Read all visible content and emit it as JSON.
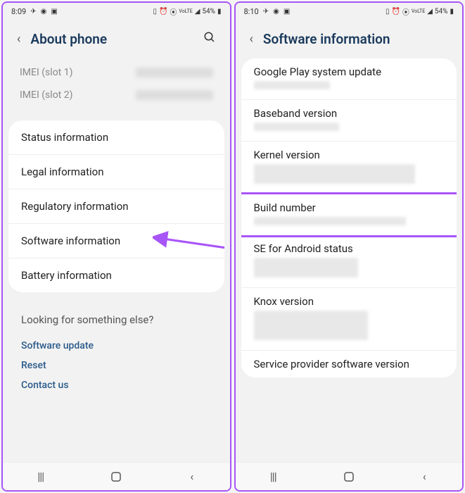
{
  "left_phone": {
    "status": {
      "time": "8:09",
      "battery": "54%"
    },
    "header": {
      "title": "About phone"
    },
    "imei": [
      {
        "label": "IMEI (slot 1)"
      },
      {
        "label": "IMEI (slot 2)"
      }
    ],
    "info_items": [
      "Status information",
      "Legal information",
      "Regulatory information",
      "Software information",
      "Battery information"
    ],
    "looking": {
      "title": "Looking for something else?",
      "links": [
        "Software update",
        "Reset",
        "Contact us"
      ]
    }
  },
  "right_phone": {
    "status": {
      "time": "8:10",
      "battery": "54%"
    },
    "header": {
      "title": "Software information"
    },
    "items": [
      {
        "title": "Google Play system update",
        "blur": "short"
      },
      {
        "title": "Baseband version",
        "blur": "short"
      },
      {
        "title": "Kernel version",
        "blur": "tall"
      },
      {
        "title": "Build number",
        "blur": "short",
        "highlight": true
      },
      {
        "title": "SE for Android status",
        "blur": "tall"
      },
      {
        "title": "Knox version",
        "blur": "xtall"
      },
      {
        "title": "Service provider software version",
        "blur": "none"
      }
    ]
  }
}
